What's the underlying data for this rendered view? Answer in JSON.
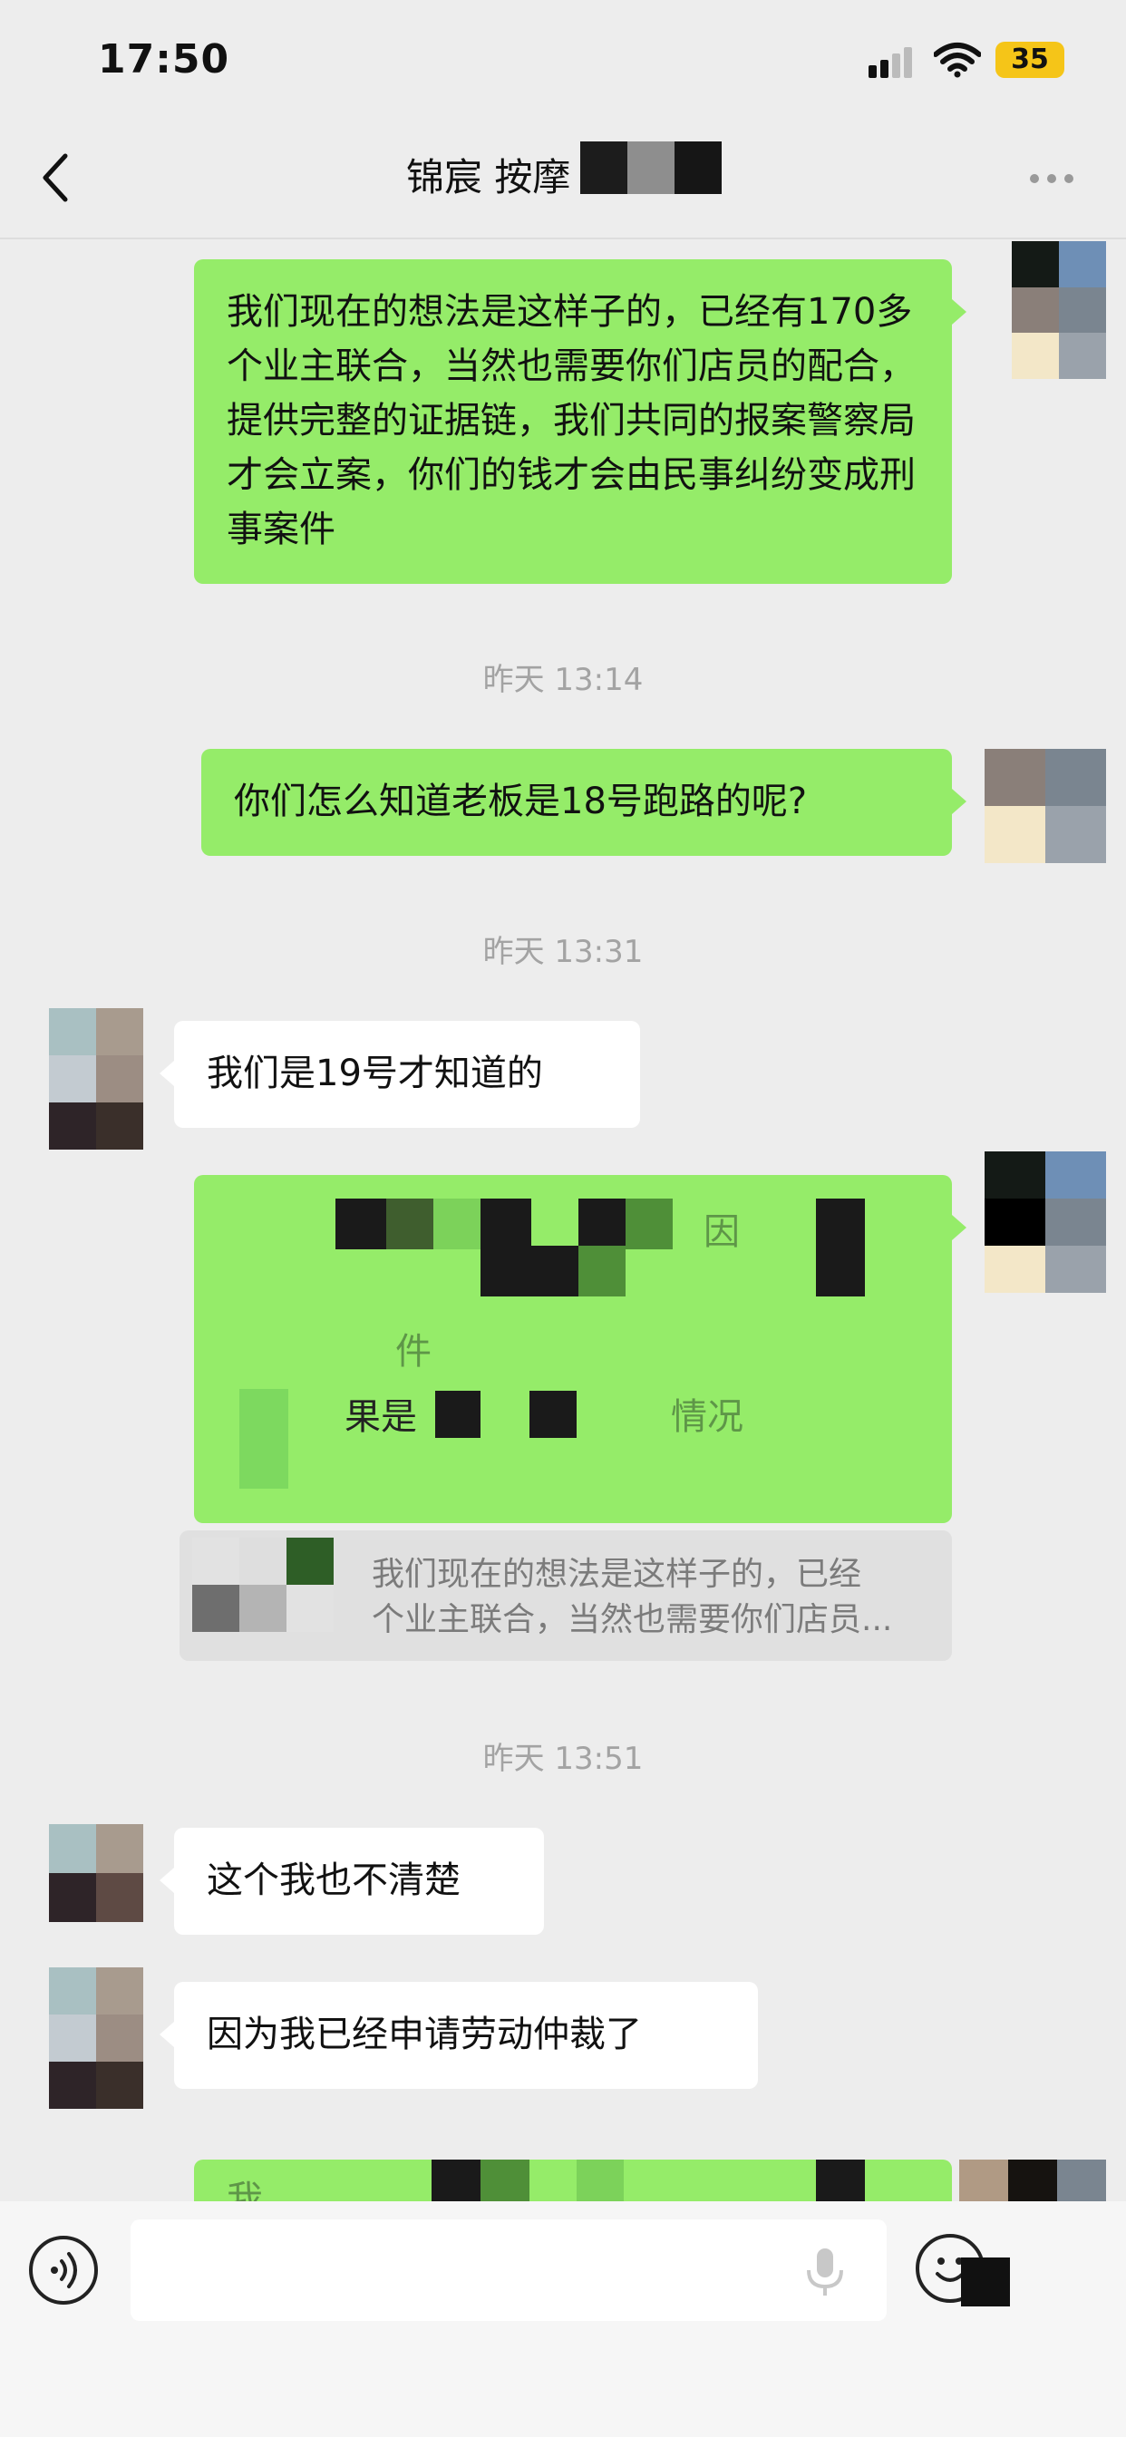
{
  "status_bar": {
    "time": "17:50",
    "battery": "35"
  },
  "nav": {
    "title": "锦宸 按摩"
  },
  "messages": {
    "m1": "我们现在的想法是这样子的，已经有170多个业主联合，当然也需要你们店员的配合，提供完整的证据链，我们共同的报案警察局才会立案，你们的钱才会由民事纠纷变成刑事案件",
    "ts1": "昨天 13:14",
    "m2": "你们怎么知道老板是18号跑路的呢?",
    "ts2": "昨天 13:31",
    "m3": "我们是19号才知道的",
    "m4_visible_1": "因",
    "m4_visible_2": "件",
    "m4_visible_3": "果是",
    "m4_visible_4": "情况",
    "quote": "我们现在的想法是这样子的，已经\n个业主联合，当然也需要你们店员...",
    "ts3": "昨天 13:51",
    "m5": "这个我也不清楚",
    "m6": "因为我已经申请劳动仲裁了",
    "m7_partial": "我"
  },
  "colors": {
    "outgoing_bubble": "#95ec69",
    "incoming_bubble": "#ffffff",
    "background": "#ededed",
    "battery": "#f5c518"
  },
  "icons": [
    "back-icon",
    "more-icon",
    "voice-icon",
    "mic-icon",
    "emoji-icon",
    "signal-icon",
    "wifi-icon"
  ]
}
